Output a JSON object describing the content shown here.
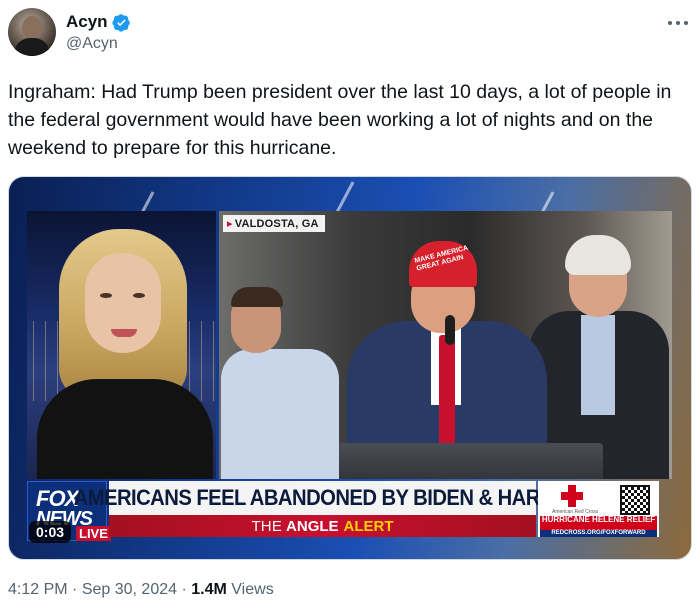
{
  "author": {
    "display_name": "Acyn",
    "handle": "@Acyn",
    "verified": true,
    "avatar_icon": "avatar-photo"
  },
  "tweet": {
    "text": "Ingraham: Had Trump been president over the last 10 days, a lot of people in the federal government would have been working a lot of nights and on the weekend to prepare for this hurricane."
  },
  "video": {
    "location_tag": "VALDOSTA, GA",
    "network_logo": {
      "line1": "FOX",
      "line2": "NEWS",
      "badge": "LIVE"
    },
    "headline": "AMERICANS FEEL ABANDONED BY BIDEN & HARRIS",
    "segment": {
      "prefix": "THE",
      "name": "ANGLE",
      "suffix": "ALERT"
    },
    "sponsor": {
      "org": "American Red Cross",
      "relief": "HURRICANE HELENE RELIEF",
      "url": "REDCROSS.ORG/FOXFORWARD"
    },
    "hat_text": "MAKE AMERICA GREAT AGAIN",
    "timestamp": "0:03"
  },
  "meta": {
    "time": "4:12 PM",
    "date": "Sep 30, 2024",
    "views_count": "1.4M",
    "views_label": "Views"
  },
  "colors": {
    "accent": "#1d9bf0",
    "text_primary": "#0f1419",
    "text_secondary": "#536471",
    "fox_red": "#c8102e",
    "fox_blue": "#0b2f7a"
  }
}
